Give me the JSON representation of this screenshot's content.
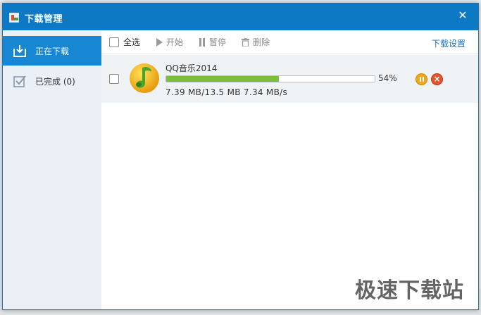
{
  "window": {
    "title": "下载管理",
    "close_glyph": "✕"
  },
  "sidebar": {
    "items": [
      {
        "label": "正在下载",
        "icon": "download-tray-icon",
        "active": true
      },
      {
        "label": "已完成 (0)",
        "icon": "checkbox-icon",
        "active": false
      }
    ]
  },
  "toolbar": {
    "select_all": "全选",
    "start": "开始",
    "pause": "暂停",
    "delete": "删除",
    "settings": "下载设置"
  },
  "downloads": [
    {
      "name": "QQ音乐2014",
      "progress_percent": 54,
      "percent_text": "54%",
      "size_text": "7.39 MB/13.5 MB 7.34 MB/s",
      "icon": "qq-music-icon"
    }
  ],
  "watermark": "极速下载站",
  "colors": {
    "titlebar": "#0d79c5",
    "active_tab": "#1787d3",
    "progress": "#7cbf3d",
    "link": "#1a6fb8"
  }
}
